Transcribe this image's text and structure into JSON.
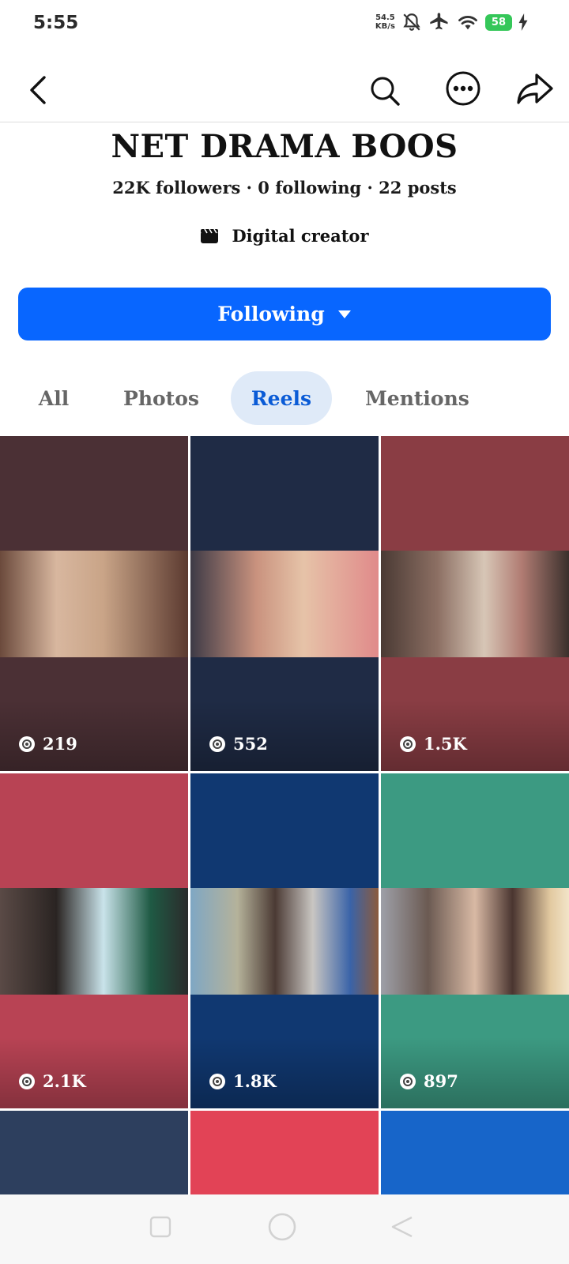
{
  "status": {
    "time": "5:55",
    "net_speed_value": "54.5",
    "net_speed_unit": "KB/s",
    "battery": "58"
  },
  "profile": {
    "name": "NET DRAMA BOOS",
    "stats": "22K followers · 0 following · 22 posts",
    "category": "Digital creator",
    "follow_button": "Following"
  },
  "tabs": [
    {
      "label": "All",
      "active": false
    },
    {
      "label": "Photos",
      "active": false
    },
    {
      "label": "Reels",
      "active": true
    },
    {
      "label": "Mentions",
      "active": false
    }
  ],
  "reels": [
    {
      "views": "219",
      "bg_color": "#4b3035"
    },
    {
      "views": "552",
      "bg_color": "#1f2b45"
    },
    {
      "views": "1.5K",
      "bg_color": "#8a3d44"
    },
    {
      "views": "2.1K",
      "bg_color": "#b84354"
    },
    {
      "views": "1.8K",
      "bg_color": "#103871"
    },
    {
      "views": "897",
      "bg_color": "#3c9a82"
    },
    {
      "views": "",
      "bg_color": "#2d3f5e"
    },
    {
      "views": "",
      "bg_color": "#e24356"
    },
    {
      "views": "",
      "bg_color": "#1765c9"
    }
  ],
  "colors": {
    "accent": "#0866ff",
    "active_tab_bg": "#dfeaf8",
    "active_tab_text": "#0a5bd6"
  },
  "icons": {
    "back": "back-arrow-icon",
    "search": "search-icon",
    "more": "more-options-icon",
    "share": "share-icon",
    "views": "eye-icon"
  }
}
